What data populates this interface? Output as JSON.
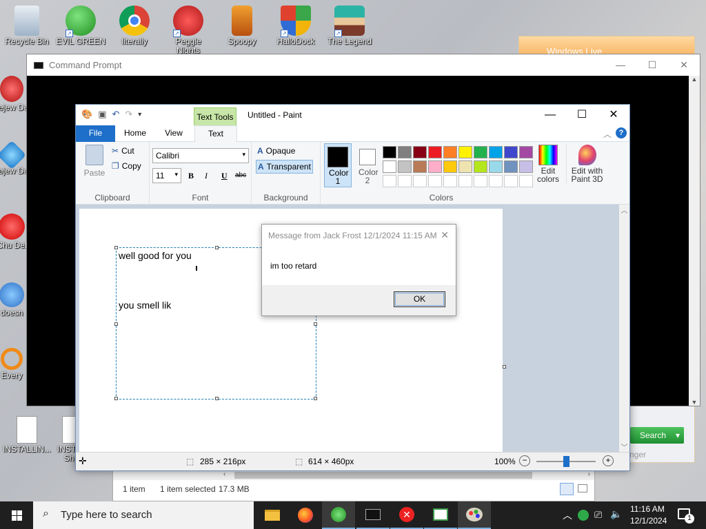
{
  "desktop": {
    "icons": [
      {
        "label": "Recycle Bin"
      },
      {
        "label": "EVIL GREEN"
      },
      {
        "label": "literally"
      },
      {
        "label": "Peggle Nights"
      },
      {
        "label": "Spoopy"
      },
      {
        "label": "HalloDock"
      },
      {
        "label": "The Legend"
      }
    ],
    "left_icons": [
      {
        "label": "Bejew Del"
      },
      {
        "label": "Bejew Del"
      },
      {
        "label": "Chu Del"
      },
      {
        "label": "doesn"
      },
      {
        "label": "Every"
      }
    ],
    "bottom_icons": [
      {
        "label": "INSTALLIN..."
      },
      {
        "label": "INST - Sh"
      }
    ]
  },
  "cmd": {
    "title": "Command Prompt"
  },
  "windows_live": {
    "title": "Windows Live",
    "search_label": "Search",
    "footer_text": "nger"
  },
  "explorer": {
    "items": "1 item",
    "selected": "1 item selected",
    "size": "17.3 MB"
  },
  "paint": {
    "title": "Untitled - Paint",
    "context_tab": "Text Tools",
    "tabs": {
      "file": "File",
      "home": "Home",
      "view": "View",
      "text": "Text"
    },
    "clipboard": {
      "paste": "Paste",
      "cut": "Cut",
      "copy": "Copy",
      "label": "Clipboard"
    },
    "font": {
      "family": "Calibri",
      "size": "11",
      "bold": "B",
      "italic": "I",
      "underline": "U",
      "strike": "abc",
      "label": "Font"
    },
    "background": {
      "opaque": "Opaque",
      "transparent": "Transparent",
      "label": "Background"
    },
    "colors": {
      "color1": "Color 1",
      "color2": "Color 2",
      "edit": "Edit colors",
      "paint3d": "Edit with Paint 3D",
      "label": "Colors",
      "row1": [
        "#000000",
        "#7f7f7f",
        "#880015",
        "#ed1c24",
        "#ff7f27",
        "#fff200",
        "#22b14c",
        "#00a2e8",
        "#3f48cc",
        "#a349a4"
      ],
      "row2": [
        "#ffffff",
        "#c3c3c3",
        "#b97a57",
        "#ffaec9",
        "#ffc90e",
        "#efe4b0",
        "#b5e61d",
        "#99d9ea",
        "#7092be",
        "#c8bfe7"
      ]
    },
    "text_lines": [
      "well good for you",
      "you smell lik"
    ],
    "status": {
      "selection": "285 × 216px",
      "canvas": "614 × 460px",
      "zoom": "100%"
    }
  },
  "message": {
    "title": "Message from Jack Frost 12/1/2024 11:15 AM",
    "body": "im too retard",
    "ok": "OK"
  },
  "taskbar": {
    "search_placeholder": "Type here to search",
    "time": "11:16 AM",
    "date": "12/1/2024",
    "notifications": "1"
  }
}
